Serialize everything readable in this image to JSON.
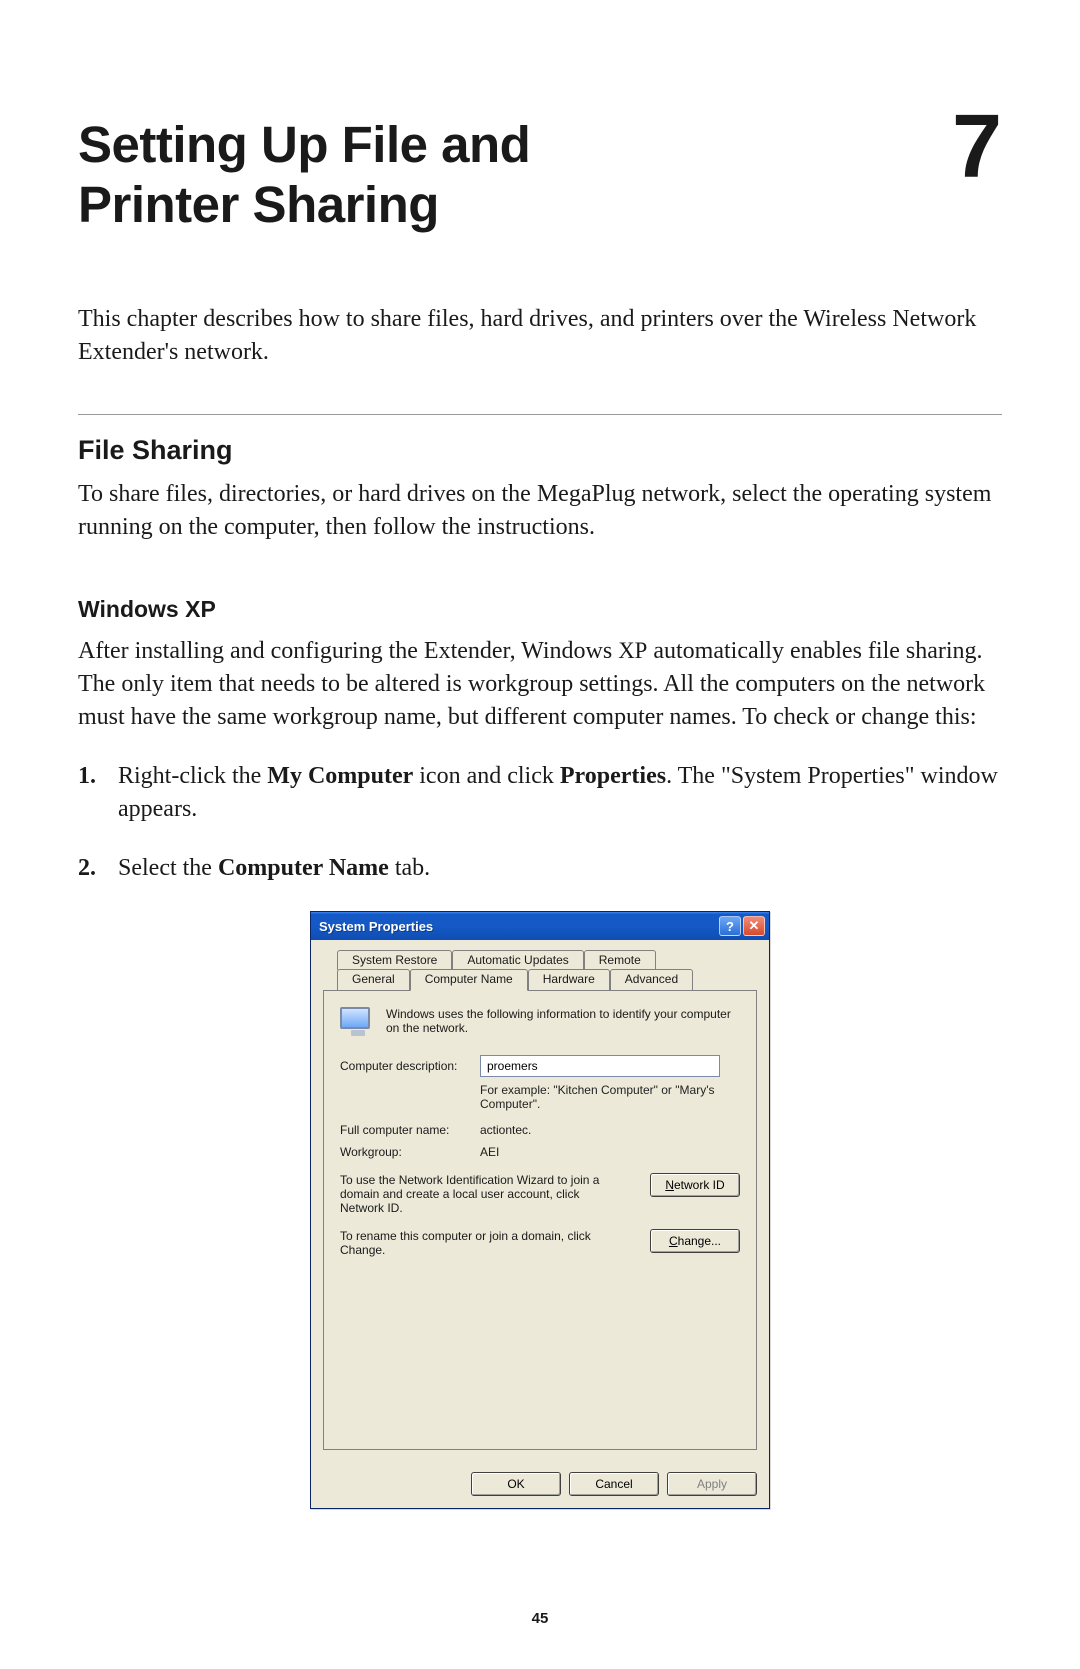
{
  "chapter": {
    "title_line1": "Setting Up File and",
    "title_line2": "Printer Sharing",
    "number": "7"
  },
  "intro": "This chapter describes how to share files, hard drives, and printers over the Wireless Network Extender's network.",
  "section": {
    "title": "File Sharing",
    "body": "To share files, directories, or hard drives on the MegaPlug network, select the operating system running on the computer, then follow the instructions."
  },
  "subsection": {
    "title": "Windows XP",
    "body_prefix": "After installing and configuring the Extender, Windows ",
    "body_xp": "XP",
    "body_suffix": " automatically enables file sharing. The only item that needs to be altered is workgroup settings. All the computers on the network must have the same workgroup name, but different computer names. To check or change this:"
  },
  "steps": {
    "s1": {
      "num": "1.",
      "a": "Right-click the ",
      "b": "My Computer",
      "c": " icon and click ",
      "d": "Properties",
      "e": ". The \"System Properties\" window appears."
    },
    "s2": {
      "num": "2.",
      "a": "Select the ",
      "b": "Computer Name",
      "c": " tab."
    }
  },
  "dialog": {
    "title": "System Properties",
    "help_glyph": "?",
    "close_glyph": "✕",
    "tabs_top": {
      "t0": "System Restore",
      "t1": "Automatic Updates",
      "t2": "Remote"
    },
    "tabs_bottom": {
      "t0": "General",
      "t1": "Computer Name",
      "t2": "Hardware",
      "t3": "Advanced"
    },
    "info": "Windows uses the following information to identify your computer on the network.",
    "desc_label": "Computer description:",
    "desc_value": "proemers",
    "desc_hint": "For example: \"Kitchen Computer\" or \"Mary's Computer\".",
    "fullname_label": "Full computer name:",
    "fullname_value": "actiontec.",
    "workgroup_label": "Workgroup:",
    "workgroup_value": "AEI",
    "networkid_text": "To use the Network Identification Wizard to join a domain and create a local user account, click Network ID.",
    "networkid_btn_u": "N",
    "networkid_btn_rest": "etwork ID",
    "change_text": "To rename this computer or join a domain, click Change.",
    "change_btn_u": "C",
    "change_btn_rest": "hange...",
    "ok": "OK",
    "cancel": "Cancel",
    "apply": "Apply"
  },
  "page_number": "45"
}
